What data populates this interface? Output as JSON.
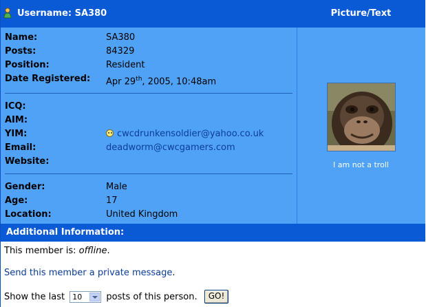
{
  "header": {
    "username_label": "Username: SA380",
    "picture_label": "Picture/Text"
  },
  "profile": {
    "name": {
      "label": "Name:",
      "value": "SA380"
    },
    "posts": {
      "label": "Posts:",
      "value": "84329"
    },
    "position": {
      "label": "Position:",
      "value": "Resident"
    },
    "date_registered": {
      "label": "Date Registered:",
      "value_pre": "Apr 29",
      "value_sup": "th",
      "value_post": ", 2005, 10:48am"
    },
    "icq": {
      "label": "ICQ:",
      "value": ""
    },
    "aim": {
      "label": "AIM:",
      "value": ""
    },
    "yim": {
      "label": "YIM:",
      "value": "cwcdrunkensoldier@yahoo.co.uk"
    },
    "email": {
      "label": "Email:",
      "value": "deadworm@cwcgamers.com"
    },
    "website": {
      "label": "Website:",
      "value": ""
    },
    "gender": {
      "label": "Gender:",
      "value": "Male"
    },
    "age": {
      "label": "Age:",
      "value": "17"
    },
    "location": {
      "label": "Location:",
      "value": "United Kingdom"
    }
  },
  "picture": {
    "caption": "I am not a troll"
  },
  "additional": {
    "title": "Additional Information:",
    "status_prefix": "This member is: ",
    "status_value": "offline",
    "status_suffix": ".",
    "pm_link": "Send this member a private message",
    "pm_suffix": ".",
    "show_prefix": "Show the last",
    "show_count": "10",
    "show_suffix": "posts of this person.",
    "go_label": "GO!"
  },
  "colors": {
    "header_bar": "#0a5ad6",
    "panel": "#4fa2f5",
    "link": "#0b3d99"
  }
}
